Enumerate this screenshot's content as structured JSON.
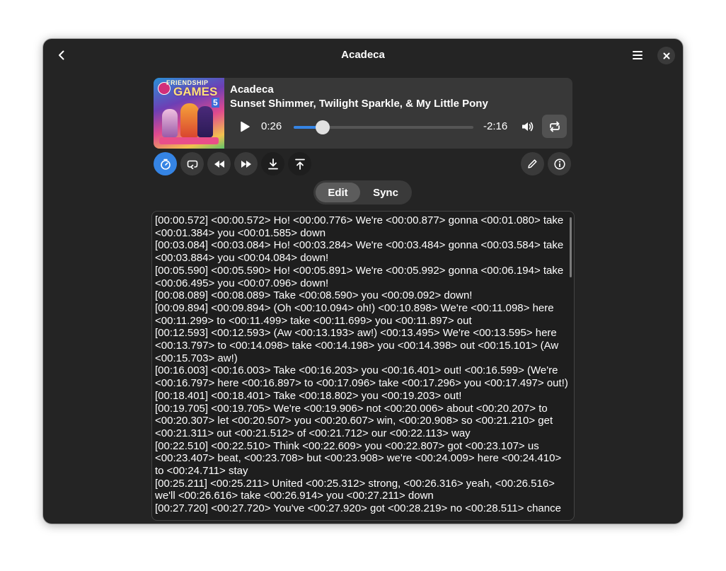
{
  "window": {
    "title": "Acadeca"
  },
  "player": {
    "song_title": "Acadeca",
    "artist": "Sunset Shimmer, Twilight Sparkle, & My Little Pony",
    "time_current": "0:26",
    "time_remaining": "-2:16",
    "progress_fraction": 0.16,
    "cover_art": {
      "logo_text": "FRIENDSHIP",
      "title_text": "GAMES",
      "number": "5"
    }
  },
  "controls": {
    "left": [
      "timer-icon",
      "loop-line-icon",
      "rewind-icon",
      "fast-forward-icon",
      "download-icon",
      "upload-icon"
    ],
    "right": [
      "edit-icon",
      "info-icon"
    ]
  },
  "mode_switcher": {
    "edit_label": "Edit",
    "sync_label": "Sync",
    "selected": "Edit"
  },
  "editor": {
    "lines": [
      "[00:00.572] <00:00.572> Ho! <00:00.776> We're <00:00.877> gonna <00:01.080> take <00:01.384> you <00:01.585> down",
      "[00:03.084] <00:03.084> Ho! <00:03.284> We're <00:03.484> gonna <00:03.584> take <00:03.884> you <00:04.084> down!",
      "[00:05.590] <00:05.590> Ho! <00:05.891> We're <00:05.992> gonna <00:06.194> take <00:06.495> you <00:07.096> down!",
      "[00:08.089] <00:08.089> Take <00:08.590> you <00:09.092> down!",
      "[00:09.894] <00:09.894> (Oh <00:10.094> oh!) <00:10.898> We're <00:11.098> here <00:11.299> to <00:11.499> take <00:11.699> you <00:11.897> out",
      "[00:12.593] <00:12.593> (Aw <00:13.193> aw!) <00:13.495> We're <00:13.595> here <00:13.797> to <00:14.098> take <00:14.198> you <00:14.398> out <00:15.101> (Aw <00:15.703> aw!)",
      "[00:16.003] <00:16.003> Take <00:16.203> you <00:16.401> out! <00:16.599> (We're <00:16.797> here <00:16.897> to <00:17.096> take <00:17.296> you <00:17.497> out!)",
      "[00:18.401] <00:18.401> Take <00:18.802> you <00:19.203> out!",
      "[00:19.705] <00:19.705> We're <00:19.906> not <00:20.006> about <00:20.207> to <00:20.307> let <00:20.507> you <00:20.607> win, <00:20.908> so <00:21.210> get <00:21.311> out <00:21.512> of <00:21.712> our <00:22.113> way",
      "[00:22.510] <00:22.510> Think <00:22.609> you <00:22.807> got <00:23.107> us <00:23.407> beat, <00:23.708> but <00:23.908> we're <00:24.009> here <00:24.410> to <00:24.711> stay",
      "[00:25.211] <00:25.211> United <00:25.312> strong, <00:26.316> yeah, <00:26.516> we'll <00:26.616> take <00:26.914> you <00:27.211> down",
      "[00:27.720] <00:27.720> You've <00:27.920> got <00:28.219> no <00:28.511> chance"
    ]
  }
}
